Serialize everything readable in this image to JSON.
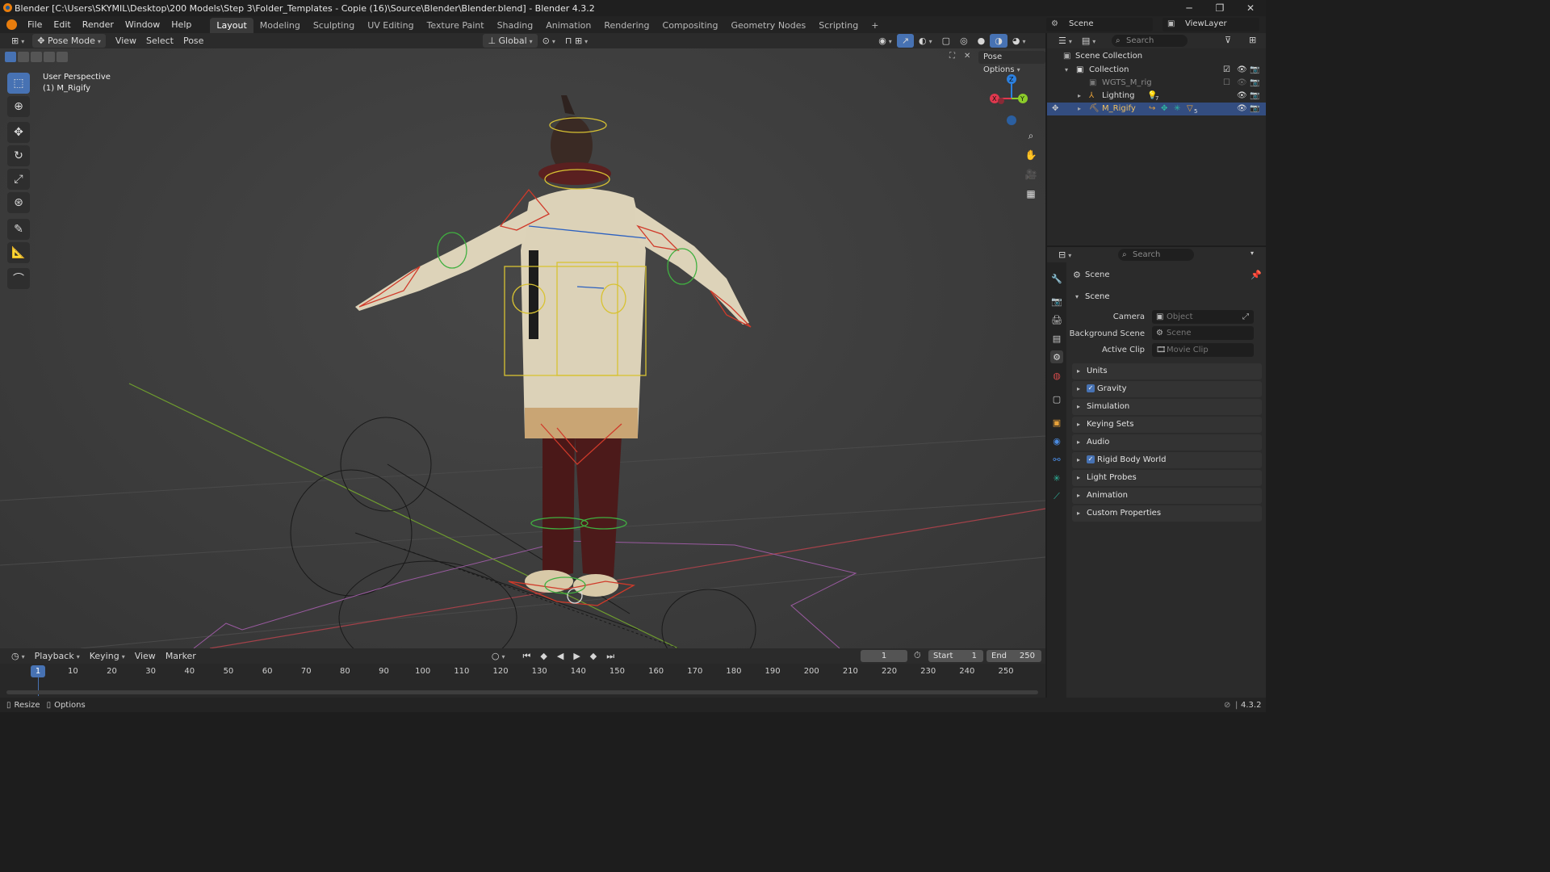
{
  "window": {
    "title": "Blender [C:\\Users\\SKYMIL\\Desktop\\200 Models\\Step 3\\Folder_Templates - Copie (16)\\Source\\Blender\\Blender.blend] - Blender 4.3.2",
    "minimize": "─",
    "maximize": "❐",
    "close": "✕"
  },
  "menubar": {
    "items": [
      "File",
      "Edit",
      "Render",
      "Window",
      "Help"
    ],
    "workspaces": [
      "Layout",
      "Modeling",
      "Sculpting",
      "UV Editing",
      "Texture Paint",
      "Shading",
      "Animation",
      "Rendering",
      "Compositing",
      "Geometry Nodes",
      "Scripting"
    ],
    "active_workspace": "Layout",
    "add_workspace": "+",
    "scene_name": "Scene",
    "view_layer": "ViewLayer"
  },
  "viewport_header": {
    "mode": "Pose Mode",
    "menus": [
      "View",
      "Select",
      "Pose"
    ],
    "orientation": "Global",
    "pose_options": "Pose Options"
  },
  "viewport": {
    "perspective_label": "User Perspective",
    "object_label": "(1) M_Rigify",
    "gizmo": {
      "x": "X",
      "y": "Y",
      "z": "Z"
    }
  },
  "timeline": {
    "menus": [
      "Playback",
      "Keying",
      "View",
      "Marker"
    ],
    "current_frame": "1",
    "start_label": "Start",
    "start": "1",
    "end_label": "End",
    "end": "250",
    "ticks": [
      "1",
      "10",
      "20",
      "30",
      "40",
      "50",
      "60",
      "70",
      "80",
      "90",
      "100",
      "110",
      "120",
      "130",
      "140",
      "150",
      "160",
      "170",
      "180",
      "190",
      "200",
      "210",
      "220",
      "230",
      "240",
      "250"
    ]
  },
  "statusbar": {
    "resize": "Resize",
    "options": "Options",
    "version": "4.3.2"
  },
  "outliner": {
    "search_placeholder": "Search",
    "rows": [
      {
        "name": "Scene Collection"
      },
      {
        "name": "Collection"
      },
      {
        "name": "WGTS_M_rig"
      },
      {
        "name": "Lighting",
        "badge": "7"
      },
      {
        "name": "M_Rigify",
        "badge": "5"
      }
    ]
  },
  "properties": {
    "search_placeholder": "Search",
    "context_title": "Scene",
    "section_scene": "Scene",
    "fields": [
      {
        "label": "Camera",
        "placeholder": "Object"
      },
      {
        "label": "Background Scene",
        "placeholder": "Scene"
      },
      {
        "label": "Active Clip",
        "placeholder": "Movie Clip"
      }
    ],
    "panels": [
      {
        "label": "Units",
        "checkbox": false
      },
      {
        "label": "Gravity",
        "checkbox": true
      },
      {
        "label": "Simulation",
        "checkbox": false
      },
      {
        "label": "Keying Sets",
        "checkbox": false
      },
      {
        "label": "Audio",
        "checkbox": false
      },
      {
        "label": "Rigid Body World",
        "checkbox": true
      },
      {
        "label": "Light Probes",
        "checkbox": false
      },
      {
        "label": "Animation",
        "checkbox": false
      },
      {
        "label": "Custom Properties",
        "checkbox": false
      }
    ]
  },
  "colors": {
    "accent": "#4772b3",
    "selection": "#334d80",
    "axis_x": "#e0384e",
    "axis_y": "#8bcb2a",
    "axis_z": "#2b80e0",
    "bone_yellow": "#d8c232",
    "bone_red": "#d03a2a",
    "bone_green": "#40b040",
    "playhead": "#4772b3"
  }
}
